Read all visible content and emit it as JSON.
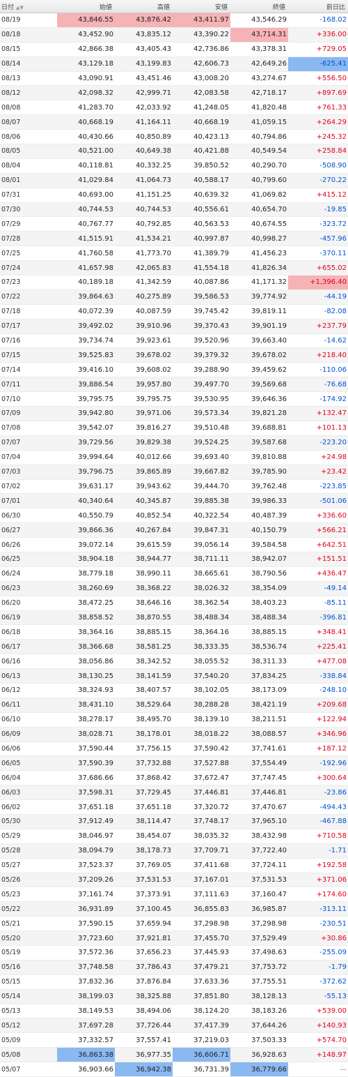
{
  "headers": [
    "日付",
    "始値",
    "高値",
    "安値",
    "終値",
    "前日比"
  ],
  "rows": [
    {
      "date": "08/19",
      "open": "43,846.55",
      "high": "43,876.42",
      "low": "43,411.97",
      "close": "43,546.29",
      "change": "-168.02",
      "dir": "down",
      "hl": {
        "open": "hi",
        "high": "hi",
        "low": "hi"
      }
    },
    {
      "date": "08/18",
      "open": "43,452.90",
      "high": "43,835.12",
      "low": "43,390.22",
      "close": "43,714.31",
      "change": "+336.00",
      "dir": "up",
      "hl": {
        "close": "hi"
      }
    },
    {
      "date": "08/15",
      "open": "42,866.38",
      "high": "43,405.43",
      "low": "42,736.86",
      "close": "43,378.31",
      "change": "+729.05",
      "dir": "up"
    },
    {
      "date": "08/14",
      "open": "43,129.18",
      "high": "43,199.83",
      "low": "42,606.73",
      "close": "42,649.26",
      "change": "-625.41",
      "dir": "down",
      "hl": {
        "change": "lo"
      }
    },
    {
      "date": "08/13",
      "open": "43,090.91",
      "high": "43,451.46",
      "low": "43,008.20",
      "close": "43,274.67",
      "change": "+556.50",
      "dir": "up"
    },
    {
      "date": "08/12",
      "open": "42,098.32",
      "high": "42,999.71",
      "low": "42,083.58",
      "close": "42,718.17",
      "change": "+897.69",
      "dir": "up"
    },
    {
      "date": "08/08",
      "open": "41,283.70",
      "high": "42,033.92",
      "low": "41,248.05",
      "close": "41,820.48",
      "change": "+761.33",
      "dir": "up"
    },
    {
      "date": "08/07",
      "open": "40,668.19",
      "high": "41,164.11",
      "low": "40,668.19",
      "close": "41,059.15",
      "change": "+264.29",
      "dir": "up"
    },
    {
      "date": "08/06",
      "open": "40,430.66",
      "high": "40,850.89",
      "low": "40,423.13",
      "close": "40,794.86",
      "change": "+245.32",
      "dir": "up"
    },
    {
      "date": "08/05",
      "open": "40,521.00",
      "high": "40,649.38",
      "low": "40,421.88",
      "close": "40,549.54",
      "change": "+258.84",
      "dir": "up"
    },
    {
      "date": "08/04",
      "open": "40,118.81",
      "high": "40,332.25",
      "low": "39,850.52",
      "close": "40,290.70",
      "change": "-508.90",
      "dir": "down"
    },
    {
      "date": "08/01",
      "open": "41,029.84",
      "high": "41,064.73",
      "low": "40,588.17",
      "close": "40,799.60",
      "change": "-270.22",
      "dir": "down"
    },
    {
      "date": "07/31",
      "open": "40,693.00",
      "high": "41,151.25",
      "low": "40,639.32",
      "close": "41,069.82",
      "change": "+415.12",
      "dir": "up"
    },
    {
      "date": "07/30",
      "open": "40,744.53",
      "high": "40,744.53",
      "low": "40,556.61",
      "close": "40,654.70",
      "change": "-19.85",
      "dir": "down"
    },
    {
      "date": "07/29",
      "open": "40,767.77",
      "high": "40,792.85",
      "low": "40,563.53",
      "close": "40,674.55",
      "change": "-323.72",
      "dir": "down"
    },
    {
      "date": "07/28",
      "open": "41,515.91",
      "high": "41,534.21",
      "low": "40,997.87",
      "close": "40,998.27",
      "change": "-457.96",
      "dir": "down"
    },
    {
      "date": "07/25",
      "open": "41,760.58",
      "high": "41,773.70",
      "low": "41,389.79",
      "close": "41,456.23",
      "change": "-370.11",
      "dir": "down"
    },
    {
      "date": "07/24",
      "open": "41,657.98",
      "high": "42,065.83",
      "low": "41,554.18",
      "close": "41,826.34",
      "change": "+655.02",
      "dir": "up"
    },
    {
      "date": "07/23",
      "open": "40,189.18",
      "high": "41,342.59",
      "low": "40,087.86",
      "close": "41,171.32",
      "change": "+1,396.40",
      "dir": "up",
      "hl": {
        "change": "hi"
      }
    },
    {
      "date": "07/22",
      "open": "39,864.63",
      "high": "40,275.89",
      "low": "39,586.53",
      "close": "39,774.92",
      "change": "-44.19",
      "dir": "down"
    },
    {
      "date": "07/18",
      "open": "40,072.39",
      "high": "40,087.59",
      "low": "39,745.42",
      "close": "39,819.11",
      "change": "-82.08",
      "dir": "down"
    },
    {
      "date": "07/17",
      "open": "39,492.02",
      "high": "39,910.96",
      "low": "39,370.43",
      "close": "39,901.19",
      "change": "+237.79",
      "dir": "up"
    },
    {
      "date": "07/16",
      "open": "39,734.74",
      "high": "39,923.61",
      "low": "39,520.96",
      "close": "39,663.40",
      "change": "-14.62",
      "dir": "down"
    },
    {
      "date": "07/15",
      "open": "39,525.83",
      "high": "39,678.02",
      "low": "39,379.32",
      "close": "39,678.02",
      "change": "+218.40",
      "dir": "up"
    },
    {
      "date": "07/14",
      "open": "39,416.10",
      "high": "39,608.02",
      "low": "39,288.90",
      "close": "39,459.62",
      "change": "-110.06",
      "dir": "down"
    },
    {
      "date": "07/11",
      "open": "39,886.54",
      "high": "39,957.80",
      "low": "39,497.70",
      "close": "39,569.68",
      "change": "-76.68",
      "dir": "down"
    },
    {
      "date": "07/10",
      "open": "39,795.75",
      "high": "39,795.75",
      "low": "39,530.95",
      "close": "39,646.36",
      "change": "-174.92",
      "dir": "down"
    },
    {
      "date": "07/09",
      "open": "39,942.80",
      "high": "39,971.06",
      "low": "39,573.34",
      "close": "39,821.28",
      "change": "+132.47",
      "dir": "up"
    },
    {
      "date": "07/08",
      "open": "39,542.07",
      "high": "39,816.27",
      "low": "39,510.48",
      "close": "39,688.81",
      "change": "+101.13",
      "dir": "up"
    },
    {
      "date": "07/07",
      "open": "39,729.56",
      "high": "39,829.38",
      "low": "39,524.25",
      "close": "39,587.68",
      "change": "-223.20",
      "dir": "down"
    },
    {
      "date": "07/04",
      "open": "39,994.64",
      "high": "40,012.66",
      "low": "39,693.40",
      "close": "39,810.88",
      "change": "+24.98",
      "dir": "up"
    },
    {
      "date": "07/03",
      "open": "39,796.75",
      "high": "39,865.89",
      "low": "39,667.82",
      "close": "39,785.90",
      "change": "+23.42",
      "dir": "up"
    },
    {
      "date": "07/02",
      "open": "39,631.17",
      "high": "39,943.62",
      "low": "39,444.70",
      "close": "39,762.48",
      "change": "-223.85",
      "dir": "down"
    },
    {
      "date": "07/01",
      "open": "40,340.64",
      "high": "40,345.87",
      "low": "39,885.38",
      "close": "39,986.33",
      "change": "-501.06",
      "dir": "down"
    },
    {
      "date": "06/30",
      "open": "40,550.79",
      "high": "40,852.54",
      "low": "40,322.54",
      "close": "40,487.39",
      "change": "+336.60",
      "dir": "up"
    },
    {
      "date": "06/27",
      "open": "39,866.36",
      "high": "40,267.84",
      "low": "39,847.31",
      "close": "40,150.79",
      "change": "+566.21",
      "dir": "up"
    },
    {
      "date": "06/26",
      "open": "39,072.14",
      "high": "39,615.59",
      "low": "39,056.14",
      "close": "39,584.58",
      "change": "+642.51",
      "dir": "up"
    },
    {
      "date": "06/25",
      "open": "38,904.18",
      "high": "38,944.77",
      "low": "38,711.11",
      "close": "38,942.07",
      "change": "+151.51",
      "dir": "up"
    },
    {
      "date": "06/24",
      "open": "38,779.18",
      "high": "38,990.11",
      "low": "38,665.61",
      "close": "38,790.56",
      "change": "+436.47",
      "dir": "up"
    },
    {
      "date": "06/23",
      "open": "38,260.69",
      "high": "38,368.22",
      "low": "38,026.32",
      "close": "38,354.09",
      "change": "-49.14",
      "dir": "down"
    },
    {
      "date": "06/20",
      "open": "38,472.25",
      "high": "38,646.16",
      "low": "38,362.54",
      "close": "38,403.23",
      "change": "-85.11",
      "dir": "down"
    },
    {
      "date": "06/19",
      "open": "38,858.52",
      "high": "38,870.55",
      "low": "38,488.34",
      "close": "38,488.34",
      "change": "-396.81",
      "dir": "down"
    },
    {
      "date": "06/18",
      "open": "38,364.16",
      "high": "38,885.15",
      "low": "38,364.16",
      "close": "38,885.15",
      "change": "+348.41",
      "dir": "up"
    },
    {
      "date": "06/17",
      "open": "38,366.68",
      "high": "38,581.25",
      "low": "38,333.35",
      "close": "38,536.74",
      "change": "+225.41",
      "dir": "up"
    },
    {
      "date": "06/16",
      "open": "38,056.86",
      "high": "38,342.52",
      "low": "38,055.52",
      "close": "38,311.33",
      "change": "+477.08",
      "dir": "up"
    },
    {
      "date": "06/13",
      "open": "38,130.25",
      "high": "38,141.59",
      "low": "37,540.20",
      "close": "37,834.25",
      "change": "-338.84",
      "dir": "down"
    },
    {
      "date": "06/12",
      "open": "38,324.93",
      "high": "38,407.57",
      "low": "38,102.05",
      "close": "38,173.09",
      "change": "-248.10",
      "dir": "down"
    },
    {
      "date": "06/11",
      "open": "38,431.10",
      "high": "38,529.64",
      "low": "38,288.28",
      "close": "38,421.19",
      "change": "+209.68",
      "dir": "up"
    },
    {
      "date": "06/10",
      "open": "38,278.17",
      "high": "38,495.70",
      "low": "38,139.10",
      "close": "38,211.51",
      "change": "+122.94",
      "dir": "up"
    },
    {
      "date": "06/09",
      "open": "38,028.71",
      "high": "38,178.01",
      "low": "38,018.22",
      "close": "38,088.57",
      "change": "+346.96",
      "dir": "up"
    },
    {
      "date": "06/06",
      "open": "37,590.44",
      "high": "37,756.15",
      "low": "37,590.42",
      "close": "37,741.61",
      "change": "+187.12",
      "dir": "up"
    },
    {
      "date": "06/05",
      "open": "37,590.39",
      "high": "37,732.88",
      "low": "37,527.88",
      "close": "37,554.49",
      "change": "-192.96",
      "dir": "down"
    },
    {
      "date": "06/04",
      "open": "37,686.66",
      "high": "37,868.42",
      "low": "37,672.47",
      "close": "37,747.45",
      "change": "+300.64",
      "dir": "up"
    },
    {
      "date": "06/03",
      "open": "37,598.31",
      "high": "37,729.45",
      "low": "37,446.81",
      "close": "37,446.81",
      "change": "-23.86",
      "dir": "down"
    },
    {
      "date": "06/02",
      "open": "37,651.18",
      "high": "37,651.18",
      "low": "37,320.72",
      "close": "37,470.67",
      "change": "-494.43",
      "dir": "down"
    },
    {
      "date": "05/30",
      "open": "37,912.49",
      "high": "38,114.47",
      "low": "37,748.17",
      "close": "37,965.10",
      "change": "-467.88",
      "dir": "down"
    },
    {
      "date": "05/29",
      "open": "38,046.97",
      "high": "38,454.07",
      "low": "38,035.32",
      "close": "38,432.98",
      "change": "+710.58",
      "dir": "up"
    },
    {
      "date": "05/28",
      "open": "38,094.79",
      "high": "38,178.73",
      "low": "37,709.71",
      "close": "37,722.40",
      "change": "-1.71",
      "dir": "down"
    },
    {
      "date": "05/27",
      "open": "37,523.37",
      "high": "37,769.05",
      "low": "37,411.68",
      "close": "37,724.11",
      "change": "+192.58",
      "dir": "up"
    },
    {
      "date": "05/26",
      "open": "37,209.26",
      "high": "37,531.53",
      "low": "37,167.01",
      "close": "37,531.53",
      "change": "+371.06",
      "dir": "up"
    },
    {
      "date": "05/23",
      "open": "37,161.74",
      "high": "37,373.91",
      "low": "37,111.63",
      "close": "37,160.47",
      "change": "+174.60",
      "dir": "up"
    },
    {
      "date": "05/22",
      "open": "36,931.89",
      "high": "37,100.45",
      "low": "36,855.83",
      "close": "36,985.87",
      "change": "-313.11",
      "dir": "down"
    },
    {
      "date": "05/21",
      "open": "37,590.15",
      "high": "37,659.94",
      "low": "37,298.98",
      "close": "37,298.98",
      "change": "-230.51",
      "dir": "down"
    },
    {
      "date": "05/20",
      "open": "37,723.60",
      "high": "37,921.81",
      "low": "37,455.70",
      "close": "37,529.49",
      "change": "+30.86",
      "dir": "up"
    },
    {
      "date": "05/19",
      "open": "37,572.36",
      "high": "37,656.23",
      "low": "37,445.93",
      "close": "37,498.63",
      "change": "-255.09",
      "dir": "down"
    },
    {
      "date": "05/16",
      "open": "37,748.58",
      "high": "37,786.43",
      "low": "37,479.21",
      "close": "37,753.72",
      "change": "-1.79",
      "dir": "down"
    },
    {
      "date": "05/15",
      "open": "37,832.36",
      "high": "37,876.84",
      "low": "37,633.36",
      "close": "37,755.51",
      "change": "-372.62",
      "dir": "down"
    },
    {
      "date": "05/14",
      "open": "38,199.03",
      "high": "38,325.88",
      "low": "37,851.80",
      "close": "38,128.13",
      "change": "-55.13",
      "dir": "down"
    },
    {
      "date": "05/13",
      "open": "38,149.53",
      "high": "38,494.06",
      "low": "38,124.20",
      "close": "38,183.26",
      "change": "+539.00",
      "dir": "up"
    },
    {
      "date": "05/12",
      "open": "37,697.28",
      "high": "37,726.44",
      "low": "37,417.39",
      "close": "37,644.26",
      "change": "+140.93",
      "dir": "up"
    },
    {
      "date": "05/09",
      "open": "37,332.57",
      "high": "37,557.41",
      "low": "37,219.03",
      "close": "37,503.33",
      "change": "+574.70",
      "dir": "up"
    },
    {
      "date": "05/08",
      "open": "36,863.38",
      "high": "36,977.35",
      "low": "36,606.71",
      "close": "36,928.63",
      "change": "+148.97",
      "dir": "up",
      "hl": {
        "open": "lo",
        "low": "lo"
      }
    },
    {
      "date": "05/07",
      "open": "36,903.66",
      "high": "36,942.38",
      "low": "36,731.39",
      "close": "36,779.66",
      "change": "—",
      "dir": "flat",
      "hl": {
        "high": "lo",
        "close": "lo"
      }
    }
  ]
}
